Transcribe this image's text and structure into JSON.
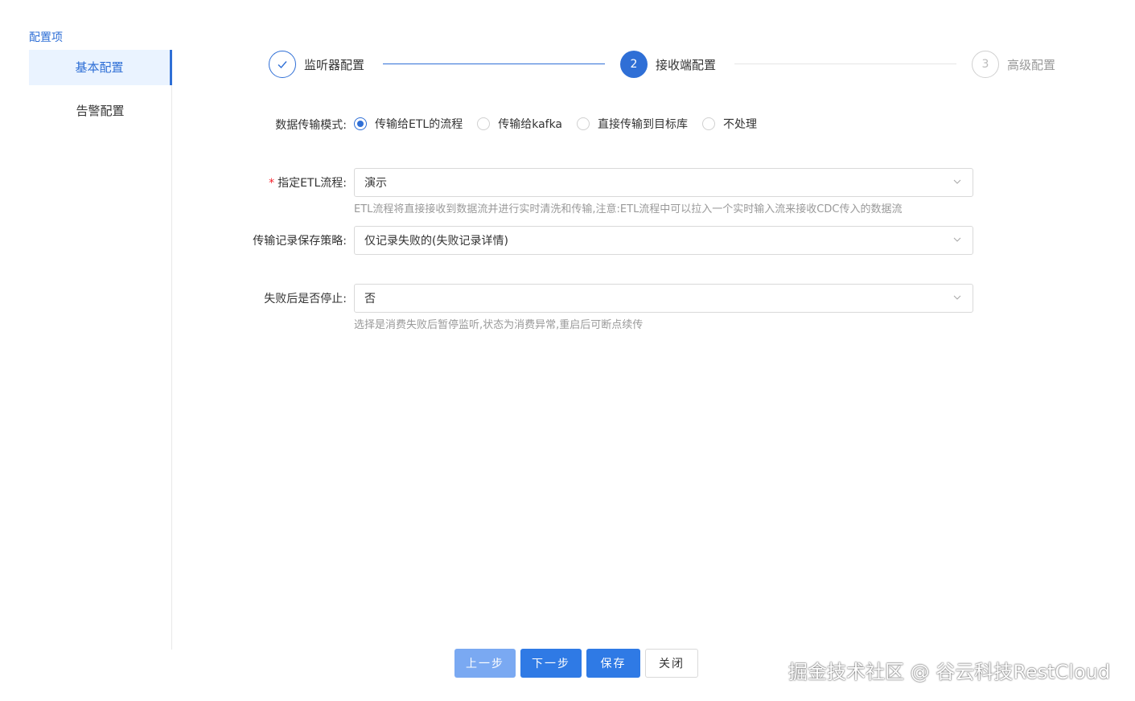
{
  "sidebar": {
    "title": "配置项",
    "items": [
      {
        "label": "基本配置",
        "active": true
      },
      {
        "label": "告警配置",
        "active": false
      }
    ]
  },
  "steps": [
    {
      "number": "1",
      "label": "监听器配置",
      "status": "done"
    },
    {
      "number": "2",
      "label": "接收端配置",
      "status": "current"
    },
    {
      "number": "3",
      "label": "高级配置",
      "status": "wait"
    }
  ],
  "form": {
    "transfer_mode": {
      "label": "数据传输模式:",
      "options": [
        "传输给ETL的流程",
        "传输给kafka",
        "直接传输到目标库",
        "不处理"
      ],
      "selected": "传输给ETL的流程"
    },
    "etl_flow": {
      "label": "指定ETL流程:",
      "value": "演示",
      "help": "ETL流程将直接接收到数据流并进行实时清洗和传输,注意:ETL流程中可以拉入一个实时输入流来接收CDC传入的数据流"
    },
    "record_policy": {
      "label": "传输记录保存策略:",
      "value": "仅记录失败的(失败记录详情)"
    },
    "stop_on_failure": {
      "label": "失败后是否停止:",
      "value": "否",
      "help": "选择是消费失败后暂停监听,状态为消费异常,重启后可断点续传"
    }
  },
  "buttons": {
    "prev": "上一步",
    "next": "下一步",
    "save": "保存",
    "close": "关闭"
  },
  "watermark": "掘金技术社区 @ 谷云科技RestCloud",
  "colors": {
    "accent": "#2f6fd6",
    "primary_button": "#2f7ae5",
    "disabled_button": "#7aa9f2"
  }
}
